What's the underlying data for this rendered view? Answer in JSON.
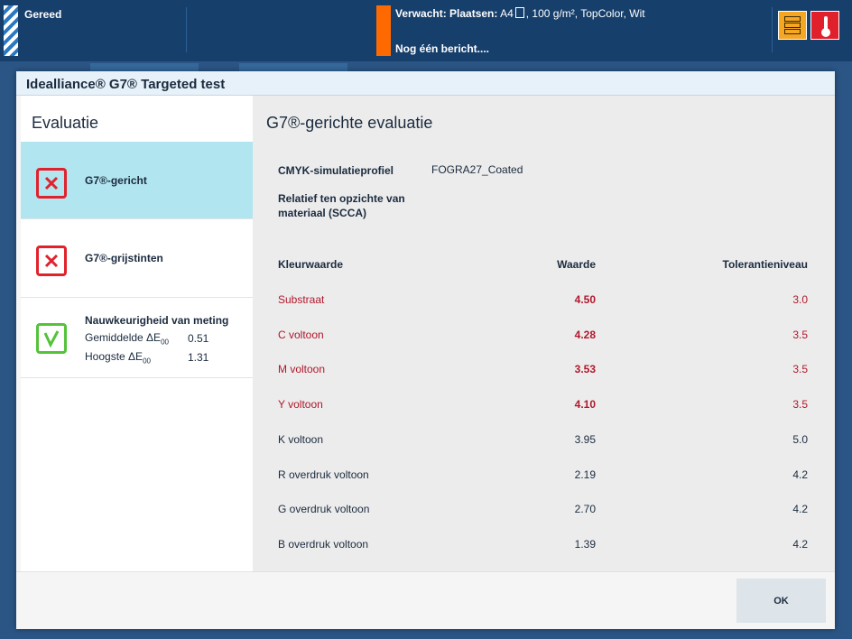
{
  "statusbar": {
    "state": "Gereed",
    "expected_label": "Verwacht: Plaatsen:",
    "expected_paper": "A4",
    "expected_details": ", 100 g/m², TopColor, Wit",
    "message": "Nog één bericht....",
    "colors": {
      "bar": "#173f6b",
      "alert": "#ff6a00",
      "storage": "#f5a623",
      "temperature": "#e0202a"
    }
  },
  "dialog": {
    "title": "Idealliance® G7® Targeted test",
    "left": {
      "heading": "Evaluatie",
      "items": [
        {
          "label": "G7®-gericht",
          "status": "fail",
          "selected": true
        },
        {
          "label": "G7®-grijstinten",
          "status": "fail",
          "selected": false
        },
        {
          "label": "Nauwkeurigheid van meting",
          "status": "pass",
          "selected": false,
          "rows": [
            {
              "label": "Gemiddelde ΔE",
              "sub": "00",
              "value": "0.51"
            },
            {
              "label": "Hoogste ΔE",
              "sub": "00",
              "value": "1.31"
            }
          ]
        }
      ]
    },
    "right": {
      "heading": "G7®-gerichte evaluatie",
      "profile_label": "CMYK-simulatieprofiel",
      "profile_value": "FOGRA27_Coated",
      "relative_label": "Relatief ten opzichte van materiaal (SCCA)",
      "table": {
        "headers": [
          "Kleurwaarde",
          "Waarde",
          "Tolerantieniveau"
        ],
        "rows": [
          {
            "name": "Substraat",
            "value": "4.50",
            "tolerance": "3.0",
            "status": "fail"
          },
          {
            "name": "C voltoon",
            "value": "4.28",
            "tolerance": "3.5",
            "status": "fail"
          },
          {
            "name": "M voltoon",
            "value": "3.53",
            "tolerance": "3.5",
            "status": "fail"
          },
          {
            "name": "Y voltoon",
            "value": "4.10",
            "tolerance": "3.5",
            "status": "fail"
          },
          {
            "name": "K voltoon",
            "value": "3.95",
            "tolerance": "5.0",
            "status": "pass"
          },
          {
            "name": "R overdruk voltoon",
            "value": "2.19",
            "tolerance": "4.2",
            "status": "pass"
          },
          {
            "name": "G overdruk voltoon",
            "value": "2.70",
            "tolerance": "4.2",
            "status": "pass"
          },
          {
            "name": "B overdruk voltoon",
            "value": "1.39",
            "tolerance": "4.2",
            "status": "pass"
          }
        ]
      }
    },
    "ok_label": "OK"
  }
}
